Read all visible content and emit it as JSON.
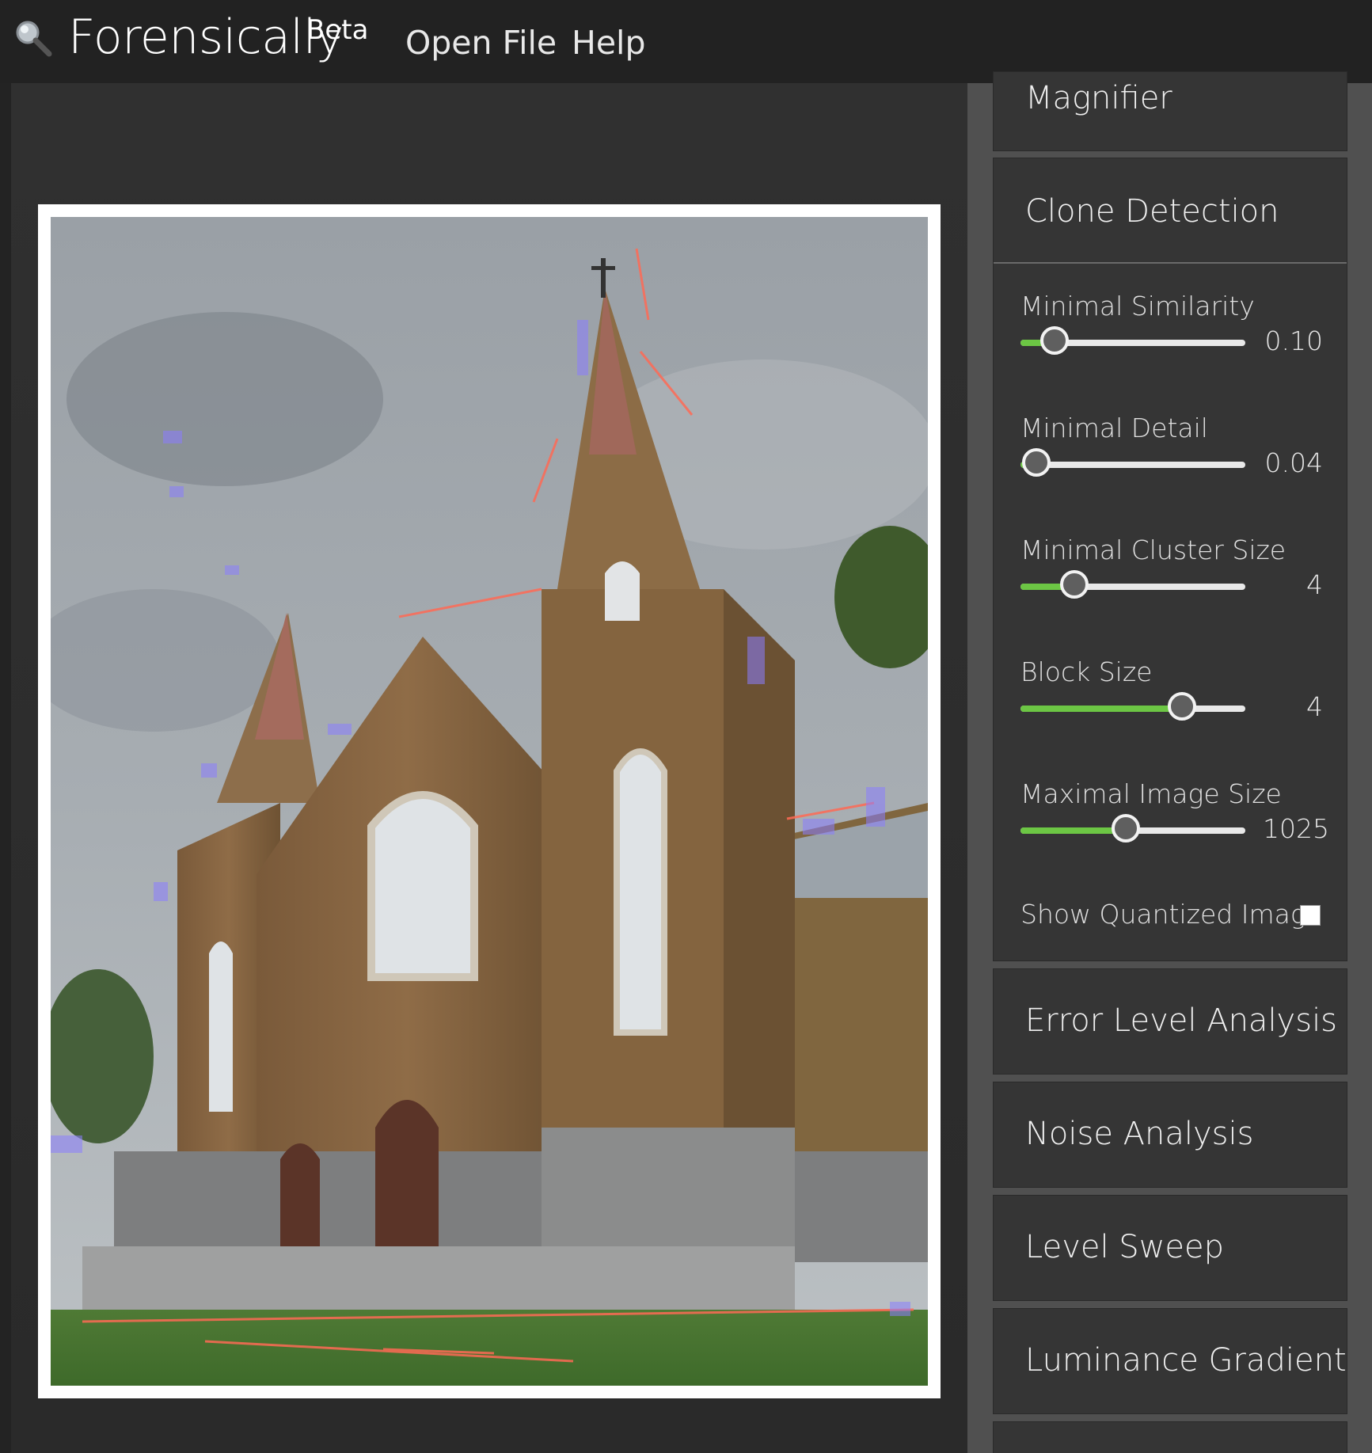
{
  "header": {
    "app_name": "Forensically",
    "badge": "Beta",
    "menu": [
      {
        "label": "Open File"
      },
      {
        "label": "Help"
      }
    ]
  },
  "sidebar": {
    "panels": [
      {
        "title": "Magnifier"
      },
      {
        "title": "Clone Detection"
      },
      {
        "title": "Error Level Analysis"
      },
      {
        "title": "Noise Analysis"
      },
      {
        "title": "Level Sweep"
      },
      {
        "title": "Luminance Gradient"
      }
    ],
    "clone_detection": {
      "sliders": [
        {
          "label": "Minimal Similarity",
          "value": "0.10",
          "fraction": 0.15
        },
        {
          "label": "Minimal Detail",
          "value": "0.04",
          "fraction": 0.07
        },
        {
          "label": "Minimal Cluster Size",
          "value": "4",
          "fraction": 0.24
        },
        {
          "label": "Block Size",
          "value": "4",
          "fraction": 0.72
        },
        {
          "label": "Maximal Image Size",
          "value": "1025",
          "fraction": 0.47
        }
      ],
      "checkbox": {
        "label": "Show Quantized Image",
        "checked": false
      }
    }
  },
  "colors": {
    "accent": "#6cc644",
    "topbar": "#222222",
    "panel": "#353535",
    "sidebar": "#505050"
  }
}
